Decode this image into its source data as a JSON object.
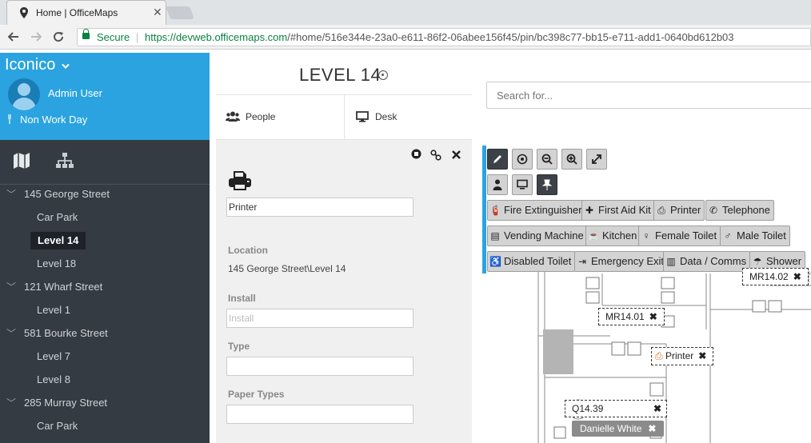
{
  "browser": {
    "tab_title": "Home | OfficeMaps",
    "tab_close": "✕",
    "secure_label": "Secure",
    "url_host": "https://devweb.officemaps.com",
    "url_path": "/#home/516e344e-23a0-e611-86f2-06abee156f45/pin/bc398c77-bb15-e711-add1-0640bd612b03"
  },
  "sidebar": {
    "brand": "Iconico",
    "user_name": "Admin User",
    "day_status": "Non Work Day",
    "tree": [
      {
        "label": "145 George Street",
        "kind": "building"
      },
      {
        "label": "Car Park",
        "kind": "level"
      },
      {
        "label": "Level 14",
        "kind": "level",
        "active": true
      },
      {
        "label": "Level 18",
        "kind": "level"
      },
      {
        "label": "121 Wharf Street",
        "kind": "building"
      },
      {
        "label": "Level 1",
        "kind": "level"
      },
      {
        "label": "581 Bourke Street",
        "kind": "building"
      },
      {
        "label": "Level 7",
        "kind": "level"
      },
      {
        "label": "Level 8",
        "kind": "level"
      },
      {
        "label": "285 Murray Street",
        "kind": "building"
      },
      {
        "label": "Car Park",
        "kind": "level"
      }
    ]
  },
  "level": {
    "title": "LEVEL 14",
    "tabs": [
      {
        "label": "People",
        "icon": "people-icon"
      },
      {
        "label": "Desk",
        "icon": "monitor-icon"
      }
    ]
  },
  "detail": {
    "name_value": "Printer",
    "location_label": "Location",
    "location_value": "145 George Street\\Level 14",
    "install_label": "Install",
    "install_placeholder": "Install",
    "type_label": "Type",
    "paper_types_label": "Paper Types"
  },
  "map": {
    "search_placeholder": "Search for...",
    "poi_buttons": [
      [
        "Fire Extinguisher",
        "First Aid Kit",
        "Printer",
        "Telephone"
      ],
      [
        "Vending Machine",
        "Kitchen",
        "Female Toilet",
        "Male Toilet"
      ],
      [
        "Disabled Toilet",
        "Emergency Exit",
        "Data / Comms",
        "Shower"
      ]
    ],
    "tags": {
      "mr1401": "MR14.01",
      "mr1402": "MR14.02",
      "printer": "Printer",
      "desk": "Q14.39",
      "person": "Danielle White"
    }
  },
  "colors": {
    "accent": "#2aa3e0",
    "sidebar_bg": "#353b43",
    "url_green": "#0b8043"
  }
}
